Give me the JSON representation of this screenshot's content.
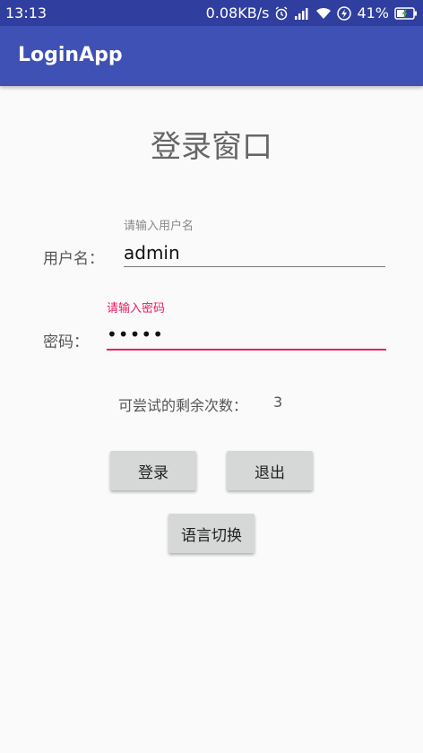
{
  "statusbar": {
    "time": "13:13",
    "speed": "0.08KB/s",
    "battery": "41%",
    "icons": [
      "alarm-icon",
      "signal-icon",
      "wifi-icon",
      "charging-icon",
      "battery-icon"
    ]
  },
  "appbar": {
    "title": "LoginApp"
  },
  "main": {
    "title": "登录窗口",
    "username": {
      "label": "用户名：",
      "hint": "请输入用户名",
      "value": "admin"
    },
    "password": {
      "label": "密码：",
      "hint": "请输入密码",
      "value": "•••••"
    },
    "attempts": {
      "label": "可尝试的剩余次数：",
      "value": "3"
    },
    "buttons": {
      "login": "登录",
      "exit": "退出",
      "language": "语言切换"
    }
  },
  "colors": {
    "primary": "#3f51b5",
    "primary_dark": "#303f9f",
    "accent": "#e91e63"
  }
}
